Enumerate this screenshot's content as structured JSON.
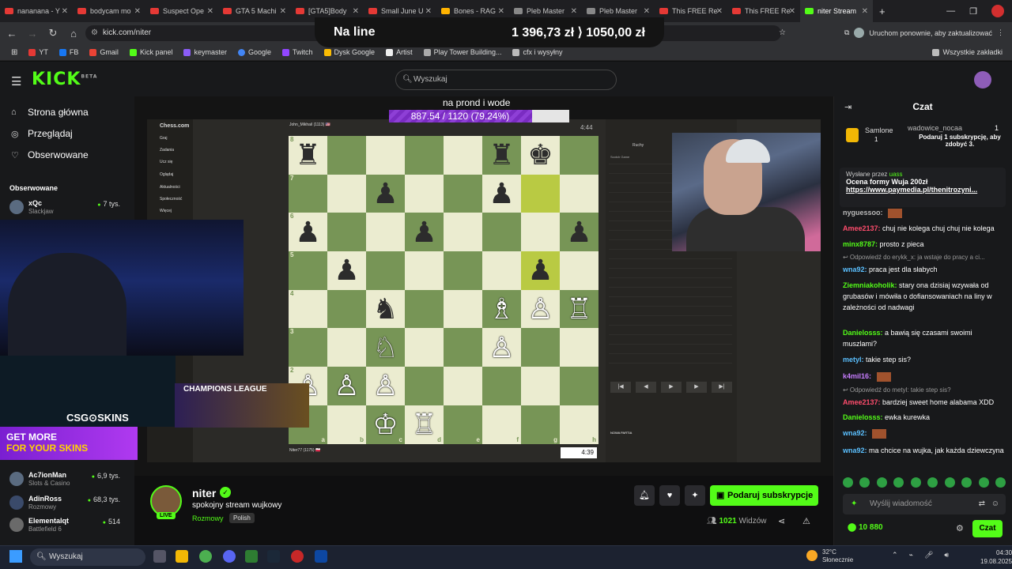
{
  "browser": {
    "tabs": [
      {
        "label": "nananana - Y"
      },
      {
        "label": "bodycam mo"
      },
      {
        "label": "Suspect Ope"
      },
      {
        "label": "GTA 5 Machi"
      },
      {
        "label": "[GTA5]Body"
      },
      {
        "label": "Small June U"
      },
      {
        "label": "Bones - RAG"
      },
      {
        "label": "Pleb Master"
      },
      {
        "label": "Pleb Master"
      },
      {
        "label": "This FREE Re"
      },
      {
        "label": "This FREE Re"
      },
      {
        "label": "niter Stream"
      }
    ],
    "url": "kick.com/niter",
    "update_text": "Uruchom ponownie, aby zaktualizować",
    "bookmarks": [
      "YT",
      "FB",
      "Gmail",
      "Kick panel",
      "keymaster",
      "Google",
      "Twitch",
      "Dysk Google",
      "Artist",
      "Play Tower Building...",
      "cfx i wysyłny"
    ],
    "all_bookmarks": "Wszystkie zakładki"
  },
  "banner": {
    "left": "Na line",
    "right": "1 396,73 zł  ⟩ 1050,00 zł"
  },
  "kick": {
    "logo": "KICK",
    "logo_tag": "BETA",
    "search_placeholder": "Wyszukaj",
    "nav": [
      {
        "label": "Strona główna",
        "icon": "home-icon"
      },
      {
        "label": "Przeglądaj",
        "icon": "browse-icon"
      },
      {
        "label": "Obserwowane",
        "icon": "heart-icon"
      }
    ],
    "followed_heading": "Obserwowane",
    "followed": [
      {
        "name": "xQc",
        "category": "Slackjaw",
        "viewers": "7 tys."
      }
    ],
    "recommended": [
      {
        "name": "Ac7ionMan",
        "category": "Slots & Casino",
        "viewers": "6,9 tys."
      },
      {
        "name": "AdinRoss",
        "category": "Rozmowy",
        "viewers": "68,3 tys."
      },
      {
        "name": "Elementalqt",
        "category": "Battlefield 6",
        "viewers": "514"
      }
    ]
  },
  "stream": {
    "caption": "na prond i wode",
    "goal_text": "887.54 / 1120 (79.24%)",
    "goal_fraction": 0.7924,
    "csg_text": "CSG⊙SKINS",
    "getmore_a": "GET MORE",
    "getmore_b": "FOR YOUR SKINS",
    "champions": "CHAMPIONS LEAGUE",
    "chess": {
      "top_player": "John_Mikhail (1113) 🇺🇸",
      "top_clock": "4:44",
      "bottom_player": "Niter77 (1175) 🇵🇱",
      "bottom_clock": "4:39",
      "site": "Chess.com",
      "menu": [
        "Graj",
        "Zadania",
        "Ucz się",
        "Oglądaj",
        "Aktualności",
        "Społeczność",
        "Więcej"
      ],
      "files": [
        "a",
        "b",
        "c",
        "d",
        "e",
        "f",
        "g",
        "h"
      ],
      "ranks": [
        "8",
        "7",
        "6",
        "5",
        "4",
        "3",
        "2",
        "1"
      ],
      "board": [
        [
          "♜",
          "",
          "",
          "",
          "",
          "♜",
          "♚",
          ""
        ],
        [
          "",
          "",
          "♟",
          "",
          "",
          "♟",
          "",
          ""
        ],
        [
          "♟",
          "",
          "",
          "♟",
          "",
          "",
          "",
          "♟"
        ],
        [
          "",
          "♟",
          "",
          "",
          "",
          "",
          "♟",
          ""
        ],
        [
          "",
          "",
          "♞",
          "",
          "",
          "♗",
          "♙",
          "♖"
        ],
        [
          "",
          "",
          "♘",
          "",
          "",
          "♙",
          "",
          ""
        ],
        [
          "♙",
          "♙",
          "♙",
          "",
          "",
          "",
          "",
          ""
        ],
        [
          "",
          "",
          "♔",
          "♖",
          "",
          "",
          "",
          ""
        ]
      ],
      "highlight": [
        [
          1,
          6
        ],
        [
          3,
          6
        ]
      ],
      "panel_title": "Ruchy",
      "panel_opening": "Scotch Game",
      "new_game": "NOWA PARTIA"
    }
  },
  "streamer": {
    "name": "niter",
    "title": "spokojny stream wujkowy",
    "category": "Rozmowy",
    "language": "Polish",
    "live_badge": "LIVE",
    "subscribe_label": "Podaruj subskrypcje",
    "viewers": "1021",
    "viewers_label": "Widzów"
  },
  "chat": {
    "title": "Czat",
    "gifter": {
      "name": "Samlone",
      "count": "1",
      "recipient": "wadowice_nocaa",
      "recipient_count": "1",
      "text": "Podaruj 1 subskrypcję, aby zdobyć 3."
    },
    "pinned": {
      "by": "Wysłane przez",
      "user": "uass",
      "line1": "Ocena formy Wuja 200zł",
      "line2": "https://www.paymedia.pl/thenitrozyni..."
    },
    "messages": [
      {
        "user": "nyguessoo:",
        "color": "#b9b9b9",
        "text": ""
      },
      {
        "user": "Amee2137:",
        "color": "#ff4d6d",
        "text": "chuj nie kolega chuj chuj nie kolega"
      },
      {
        "user": "minx8787:",
        "color": "#53fc18",
        "text": "prosto z pieca"
      },
      {
        "reply": "Odpowiedź do erykk_x: ja wstaje do pracy a ci..."
      },
      {
        "user": "wna92:",
        "color": "#5bc0ff",
        "text": "praca jest dla słabych"
      },
      {
        "user": "Ziemniakoholik:",
        "color": "#53fc18",
        "text": "stary ona dzisiaj wzywała od grubasów i mówiła o dofiansowaniach na liny w zależności od nadwagi"
      },
      {
        "user": "Danielosss:",
        "color": "#53fc18",
        "text": "a bawią się czasami swoimi muszlami?"
      },
      {
        "user": "metyl:",
        "color": "#5bc0ff",
        "text": "takie step sis?"
      },
      {
        "user": "k4mil16:",
        "color": "#c77dff",
        "text": ""
      },
      {
        "reply": "Odpowiedź do metyl: takie step sis?"
      },
      {
        "user": "Amee2137:",
        "color": "#ff4d6d",
        "text": "bardziej sweet home alabama XDD"
      },
      {
        "user": "Danielosss:",
        "color": "#53fc18",
        "text": "ewka kurewka"
      },
      {
        "user": "wna92:",
        "color": "#5bc0ff",
        "text": ""
      },
      {
        "user": "wna92:",
        "color": "#5bc0ff",
        "text": "ma chcice na wujka, jak każda dziewczyna"
      }
    ],
    "input_placeholder": "Wyślij wiadomość",
    "points": "10 880",
    "send_label": "Czat"
  },
  "taskbar": {
    "search": "Wyszukaj",
    "weather_temp": "32°C",
    "weather_desc": "Słonecznie",
    "time": "04:30",
    "date": "19.08.2025"
  }
}
